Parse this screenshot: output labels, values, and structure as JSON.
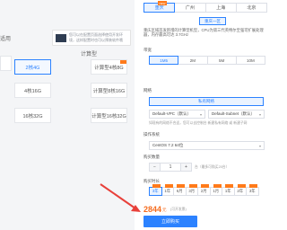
{
  "left": {
    "tip": "您可以在配置页面选择使用开发环境，这样配置时也可以预装软件哦",
    "partial_a": "适用",
    "partial_b": "计算型",
    "cards": [
      "2核4G",
      "计算型4核8G",
      "4核16G",
      "计算型8核16G",
      "16核32G",
      "计算型16核32G"
    ]
  },
  "panel": {
    "regions": [
      {
        "label": "重庆",
        "badge": "NEW"
      },
      {
        "label": "广州"
      },
      {
        "label": "上海"
      },
      {
        "label": "北京"
      }
    ],
    "zone": "重庆一区",
    "description": "重庆区域首发新增的计算型机型，CPU为第三代英特尔至强可扩展处理器，内存最高可达 3.7GHz",
    "bandwidth_label": "带宽",
    "bandwidth_options": [
      "1M5",
      "2M",
      "5M",
      "10M"
    ],
    "network_label": "网络",
    "network_button": "私有网络",
    "vpc_value": "Default-VPC（默认）",
    "subnet_value": "Default-Subnet（默认）",
    "network_note": "如现有的网络不合适，您可以去控制台 新建私有网络 或 新建子网",
    "os_label": "操作系统",
    "os_value": "CentOS 7.2 64位",
    "qty_label": "购买数量",
    "qty_minus": "−",
    "qty_value": "1",
    "qty_plus": "+",
    "qty_note": "台（最多可购买20台）",
    "duration_label": "购买时长",
    "durations": [
      "3年",
      "1年",
      "6月",
      "3月",
      "2月",
      "1月",
      "1年",
      "2年",
      "3年"
    ],
    "price": "2844",
    "price_unit": "元",
    "price_note": "(可开发票)",
    "buy_button": "立即购买"
  },
  "colors": {
    "accent": "#2c82ff",
    "price": "#f56c1e",
    "badge": "#ff7a1a",
    "arrow": "#e8403a"
  }
}
